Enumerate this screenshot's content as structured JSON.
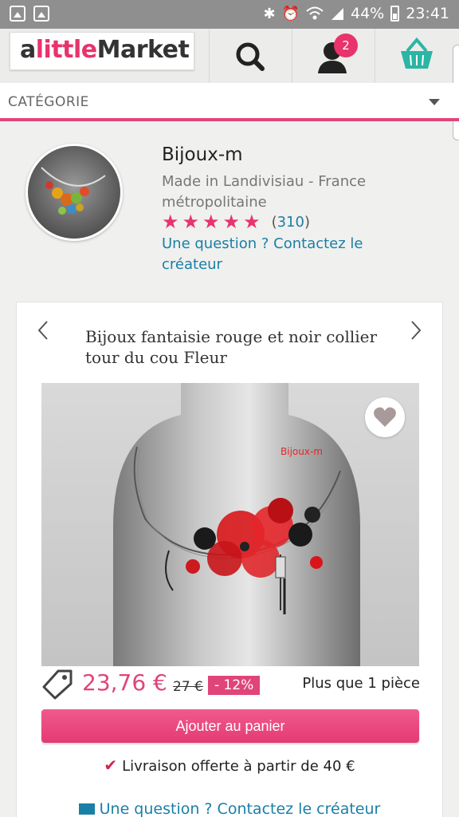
{
  "status_bar": {
    "battery": "44%",
    "time": "23:41"
  },
  "header": {
    "logo": {
      "part1": "a",
      "part2": "little",
      "part3": "Market"
    },
    "notification_count": "2"
  },
  "category": {
    "label": "CATÉGORIE"
  },
  "shop": {
    "name": "Bijoux-m",
    "location": "Made in Landivisiau - France métropolitaine",
    "rating_stars": 5,
    "review_count_open": "(",
    "review_count": "310",
    "review_count_close": ")",
    "contact": "Une question ? Contactez le créateur"
  },
  "product": {
    "title": "Bijoux fantaisie rouge et noir collier tour du cou Fleur",
    "photo_watermark": "Bijoux-m",
    "price": "23,76 €",
    "old_price": "27 €",
    "discount": "- 12%",
    "stock": "Plus que 1 pièce",
    "add_to_cart": "Ajouter au panier",
    "delivery": "Livraison offerte à partir de 40 €",
    "contact": "Une question ? Contactez le créateur"
  },
  "colors": {
    "accent": "#e8336d",
    "link": "#1a7fa6",
    "teal": "#2bb5a5"
  },
  "icons": [
    "image-icon",
    "gallery-icon",
    "bluetooth-icon",
    "alarm-icon",
    "wifi-icon",
    "signal-icon",
    "battery-icon",
    "search-icon",
    "user-icon",
    "cart-icon",
    "chevron-down-icon",
    "star-icon",
    "chevron-left-icon",
    "chevron-right-icon",
    "heart-icon",
    "price-tag-icon",
    "check-icon",
    "mail-icon"
  ]
}
